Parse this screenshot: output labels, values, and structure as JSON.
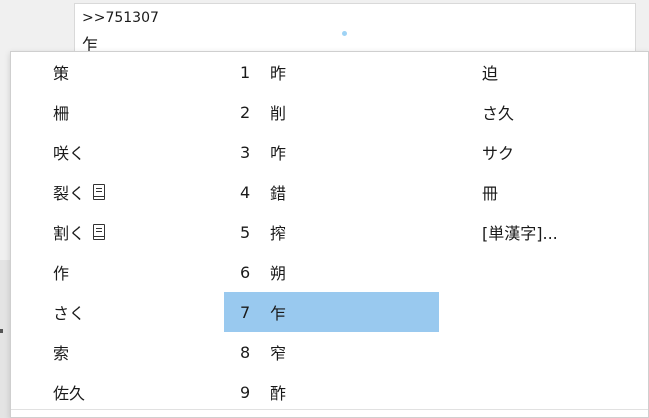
{
  "editor": {
    "code_line": ">>751307",
    "composition": "乍"
  },
  "candidates": {
    "left": [
      {
        "text": "策",
        "dict_icon": false
      },
      {
        "text": "柵",
        "dict_icon": false
      },
      {
        "text": "咲く",
        "dict_icon": false
      },
      {
        "text": "裂く",
        "dict_icon": true
      },
      {
        "text": "割く",
        "dict_icon": true
      },
      {
        "text": "作",
        "dict_icon": false
      },
      {
        "text": "さく",
        "dict_icon": false
      },
      {
        "text": "索",
        "dict_icon": false
      },
      {
        "text": "佐久",
        "dict_icon": false
      }
    ],
    "middle": [
      {
        "num": "1",
        "text": "昨"
      },
      {
        "num": "2",
        "text": "削"
      },
      {
        "num": "3",
        "text": "咋"
      },
      {
        "num": "4",
        "text": "錯"
      },
      {
        "num": "5",
        "text": "搾"
      },
      {
        "num": "6",
        "text": "朔"
      },
      {
        "num": "7",
        "text": "乍"
      },
      {
        "num": "8",
        "text": "窄"
      },
      {
        "num": "9",
        "text": "酢"
      }
    ],
    "right": [
      {
        "text": "迫"
      },
      {
        "text": "さ久"
      },
      {
        "text": "サク"
      },
      {
        "text": "冊"
      },
      {
        "text": "[単漢字]..."
      }
    ],
    "selected_index": 6
  },
  "colors": {
    "selection": "#99c9ef",
    "popup_bg": "#ffffff",
    "border": "#cfcfcf"
  }
}
